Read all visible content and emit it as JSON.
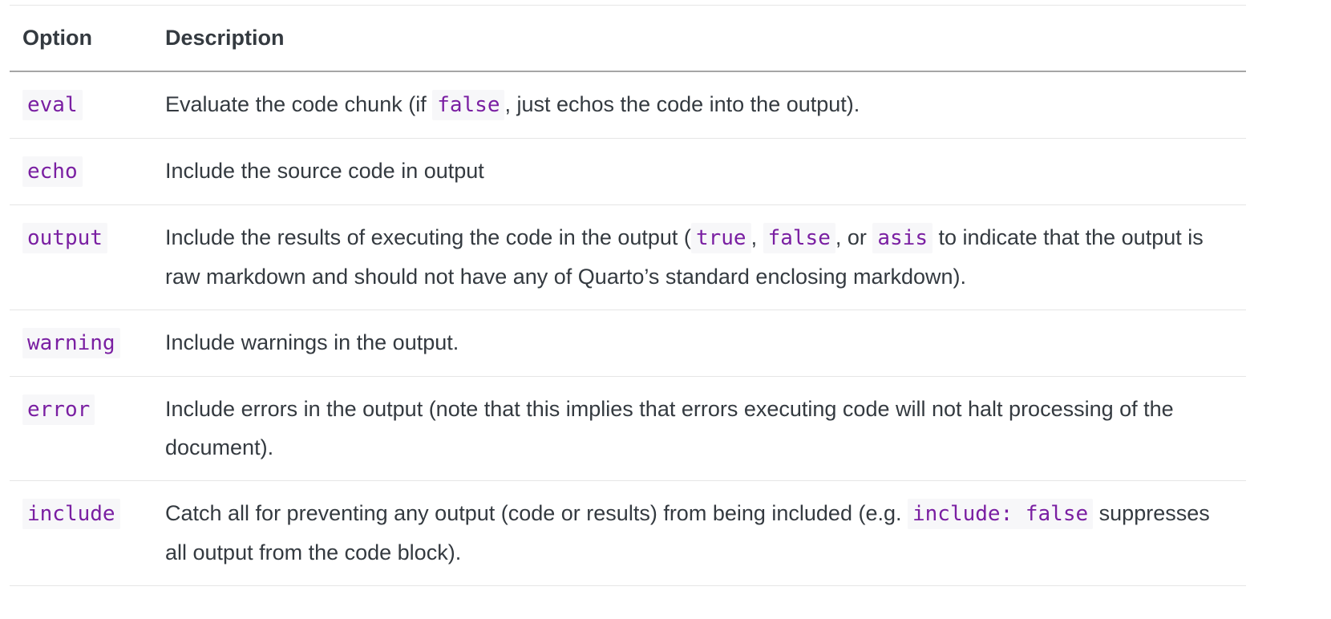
{
  "table": {
    "headers": [
      "Option",
      "Description"
    ],
    "rows": [
      {
        "option": "eval",
        "segments": [
          {
            "t": "Evaluate the code chunk (if "
          },
          {
            "c": "false"
          },
          {
            "t": ", just echos the code into the output)."
          }
        ]
      },
      {
        "option": "echo",
        "segments": [
          {
            "t": "Include the source code in output"
          }
        ]
      },
      {
        "option": "output",
        "segments": [
          {
            "t": "Include the results of executing the code in the output ("
          },
          {
            "c": "true"
          },
          {
            "t": ", "
          },
          {
            "c": "false"
          },
          {
            "t": ", or "
          },
          {
            "c": "asis"
          },
          {
            "t": " to indicate that the output is raw markdown and should not have any of Quarto’s standard enclosing markdown)."
          }
        ]
      },
      {
        "option": "warning",
        "segments": [
          {
            "t": "Include warnings in the output."
          }
        ]
      },
      {
        "option": "error",
        "segments": [
          {
            "t": "Include errors in the output (note that this implies that errors executing code will not halt processing of the document)."
          }
        ]
      },
      {
        "option": "include",
        "segments": [
          {
            "t": "Catch all for preventing any output (code or results) from being included (e.g. "
          },
          {
            "c": "include: false"
          },
          {
            "t": " suppresses all output from the code block)."
          }
        ]
      }
    ]
  },
  "colors": {
    "code_text": "#7a1fa2",
    "code_bg": "#f7f7f9",
    "body_text": "#343a40"
  }
}
